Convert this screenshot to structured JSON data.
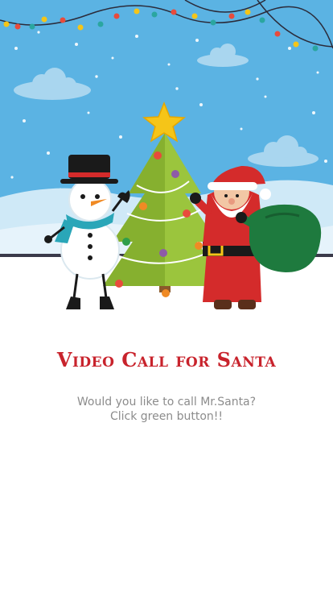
{
  "screen": {
    "title": "Video Call for Santa",
    "message_line1": "Would you like to call Mr.Santa?",
    "message_line2": "Click green button!!"
  },
  "illustration": {
    "scene": "christmas-scene",
    "elements": [
      "string-lights",
      "snowman",
      "christmas-tree",
      "santa-claus",
      "gift-sack",
      "clouds",
      "snowfall"
    ],
    "colors": {
      "sky": "#5bb3e3",
      "hills": "#cfe9f7",
      "ground": "#ffffff",
      "tree": "#9bc53d",
      "santa_red": "#d42b2b",
      "sack_green": "#1e7a3e",
      "star": "#f5c518",
      "title_red": "#c8232c"
    }
  }
}
